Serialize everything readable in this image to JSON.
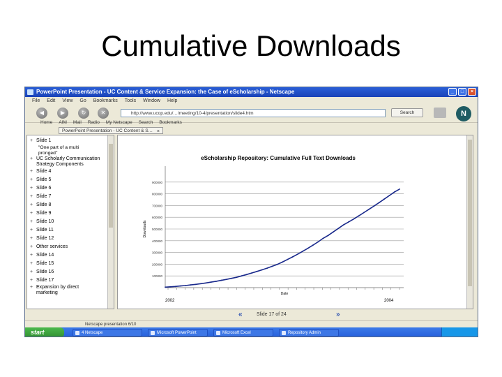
{
  "slide": {
    "title": "Cumulative Downloads"
  },
  "window": {
    "title": "PowerPoint Presentation - UC Content & Service Expansion: the Case of eScholarship - Netscape",
    "minimize": "_",
    "maximize": "□",
    "close": "×"
  },
  "menu": [
    "File",
    "Edit",
    "View",
    "Go",
    "Bookmarks",
    "Tools",
    "Window",
    "Help"
  ],
  "nav": {
    "back": "◀",
    "forward": "▶",
    "reload": "↻",
    "stop": "✕",
    "url": "http://www.ucop.edu/…/meeting/10-4/presentation/slide4.htm",
    "search": "Search"
  },
  "personal_toolbar": [
    "Home",
    "AIM",
    "Mail",
    "Radio",
    "My Netscape",
    "Search",
    "Bookmarks"
  ],
  "tab": {
    "label": "PowerPoint Presentation - UC Content & S…",
    "close": "×"
  },
  "outline": [
    {
      "label": "Slide 1"
    },
    {
      "label": "\"One part of a multi pronged\"",
      "sub": true
    },
    {
      "label": "UC Scholarly Communication Strategy Components",
      "sub": true
    },
    {
      "label": "Slide 4"
    },
    {
      "label": "Slide 5"
    },
    {
      "label": "Slide 6"
    },
    {
      "label": "Slide 7"
    },
    {
      "label": "Slide 8"
    },
    {
      "label": "Slide 9"
    },
    {
      "label": "Slide 10"
    },
    {
      "label": "Slide 11"
    },
    {
      "label": "Slide 12"
    },
    {
      "label": "Other services"
    },
    {
      "label": "Slide 14"
    },
    {
      "label": "Slide 15"
    },
    {
      "label": "Slide 16"
    },
    {
      "label": "Slide 17"
    },
    {
      "label": "Expansion by direct marketing"
    }
  ],
  "chart_data": {
    "type": "line",
    "title": "eScholarship Repository: Cumulative Full Text Downloads",
    "xlabel": "Date",
    "ylabel": "Downloads",
    "x_ticks_year": [
      "2002",
      "2004"
    ],
    "ylim": [
      0,
      1000000
    ],
    "yticks": [
      100000,
      200000,
      300000,
      400000,
      500000,
      600000,
      700000,
      800000,
      900000
    ],
    "grid": true,
    "series": [
      {
        "values": [
          4000,
          7000,
          10000,
          14000,
          18000,
          23000,
          28000,
          34000,
          40000,
          47000,
          54000,
          62000,
          70000,
          79000,
          88000,
          100000,
          112000,
          125000,
          138000,
          152000,
          166000,
          182000,
          198000,
          218000,
          240000,
          262000,
          285000,
          310000,
          335000,
          362000,
          390000,
          420000,
          445000,
          475000,
          505000,
          535000,
          560000,
          585000,
          612000,
          640000,
          668000,
          696000,
          725000,
          755000,
          785000,
          815000,
          840000
        ]
      }
    ]
  },
  "slide_nav": {
    "prev": "«",
    "next": "»",
    "counter": "Slide 17 of 24"
  },
  "status": "Netscape presentation 6/10",
  "taskbar": {
    "start": "start",
    "items": [
      "4 Netscape",
      "Microsoft PowerPoint",
      "Microsoft Excel",
      "Repository Admin"
    ]
  }
}
